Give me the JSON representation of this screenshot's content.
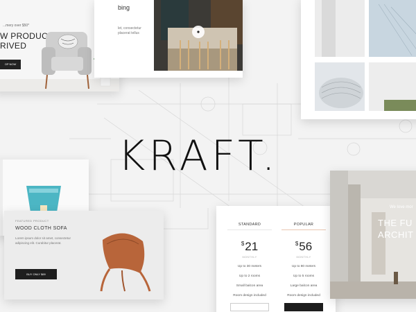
{
  "logo": {
    "text": "KRAFT."
  },
  "hero_product": {
    "small_text": "...mery over $50*",
    "title_line1": "W PRODUCT",
    "title_line2": "RIVED",
    "button_label": "OP NOW"
  },
  "interior": {
    "heading": "bing",
    "desc_line1": "let, consectetur",
    "desc_line2": "placerat tellus"
  },
  "featured": {
    "label": "FEATURED PRODUCT",
    "name": "WOOD CLOTH SOFA",
    "desc_line1": "Lorem ipsum dolor sit amet, consectetur",
    "desc_line2": "adipiscing elit. Curabitur placerat.",
    "button_label": "BUY ONLY $69"
  },
  "pricing": {
    "plans": [
      {
        "name": "STANDARD",
        "currency": "$",
        "price": "21",
        "period": "MONTHLY",
        "features": [
          "Up to 30 meters",
          "Up to 2 rooms",
          "Small balcon area",
          "Room design included"
        ]
      },
      {
        "name": "POPULAR",
        "currency": "$",
        "price": "56",
        "period": "MONTHLY",
        "features": [
          "Up to 80 meters",
          "Up to 5 rooms",
          "Large balcon area",
          "Room design included"
        ]
      }
    ]
  },
  "arch_hero": {
    "tagline": "We love mor",
    "title_line1": "THE FU",
    "title_line2": "ARCHIT"
  },
  "colors": {
    "background": "#f3f3f3",
    "dark_button": "#1c1c1c",
    "card": "#ffffff",
    "glass_accent": "#4cb6c4",
    "chair_wood": "#b8653a"
  }
}
